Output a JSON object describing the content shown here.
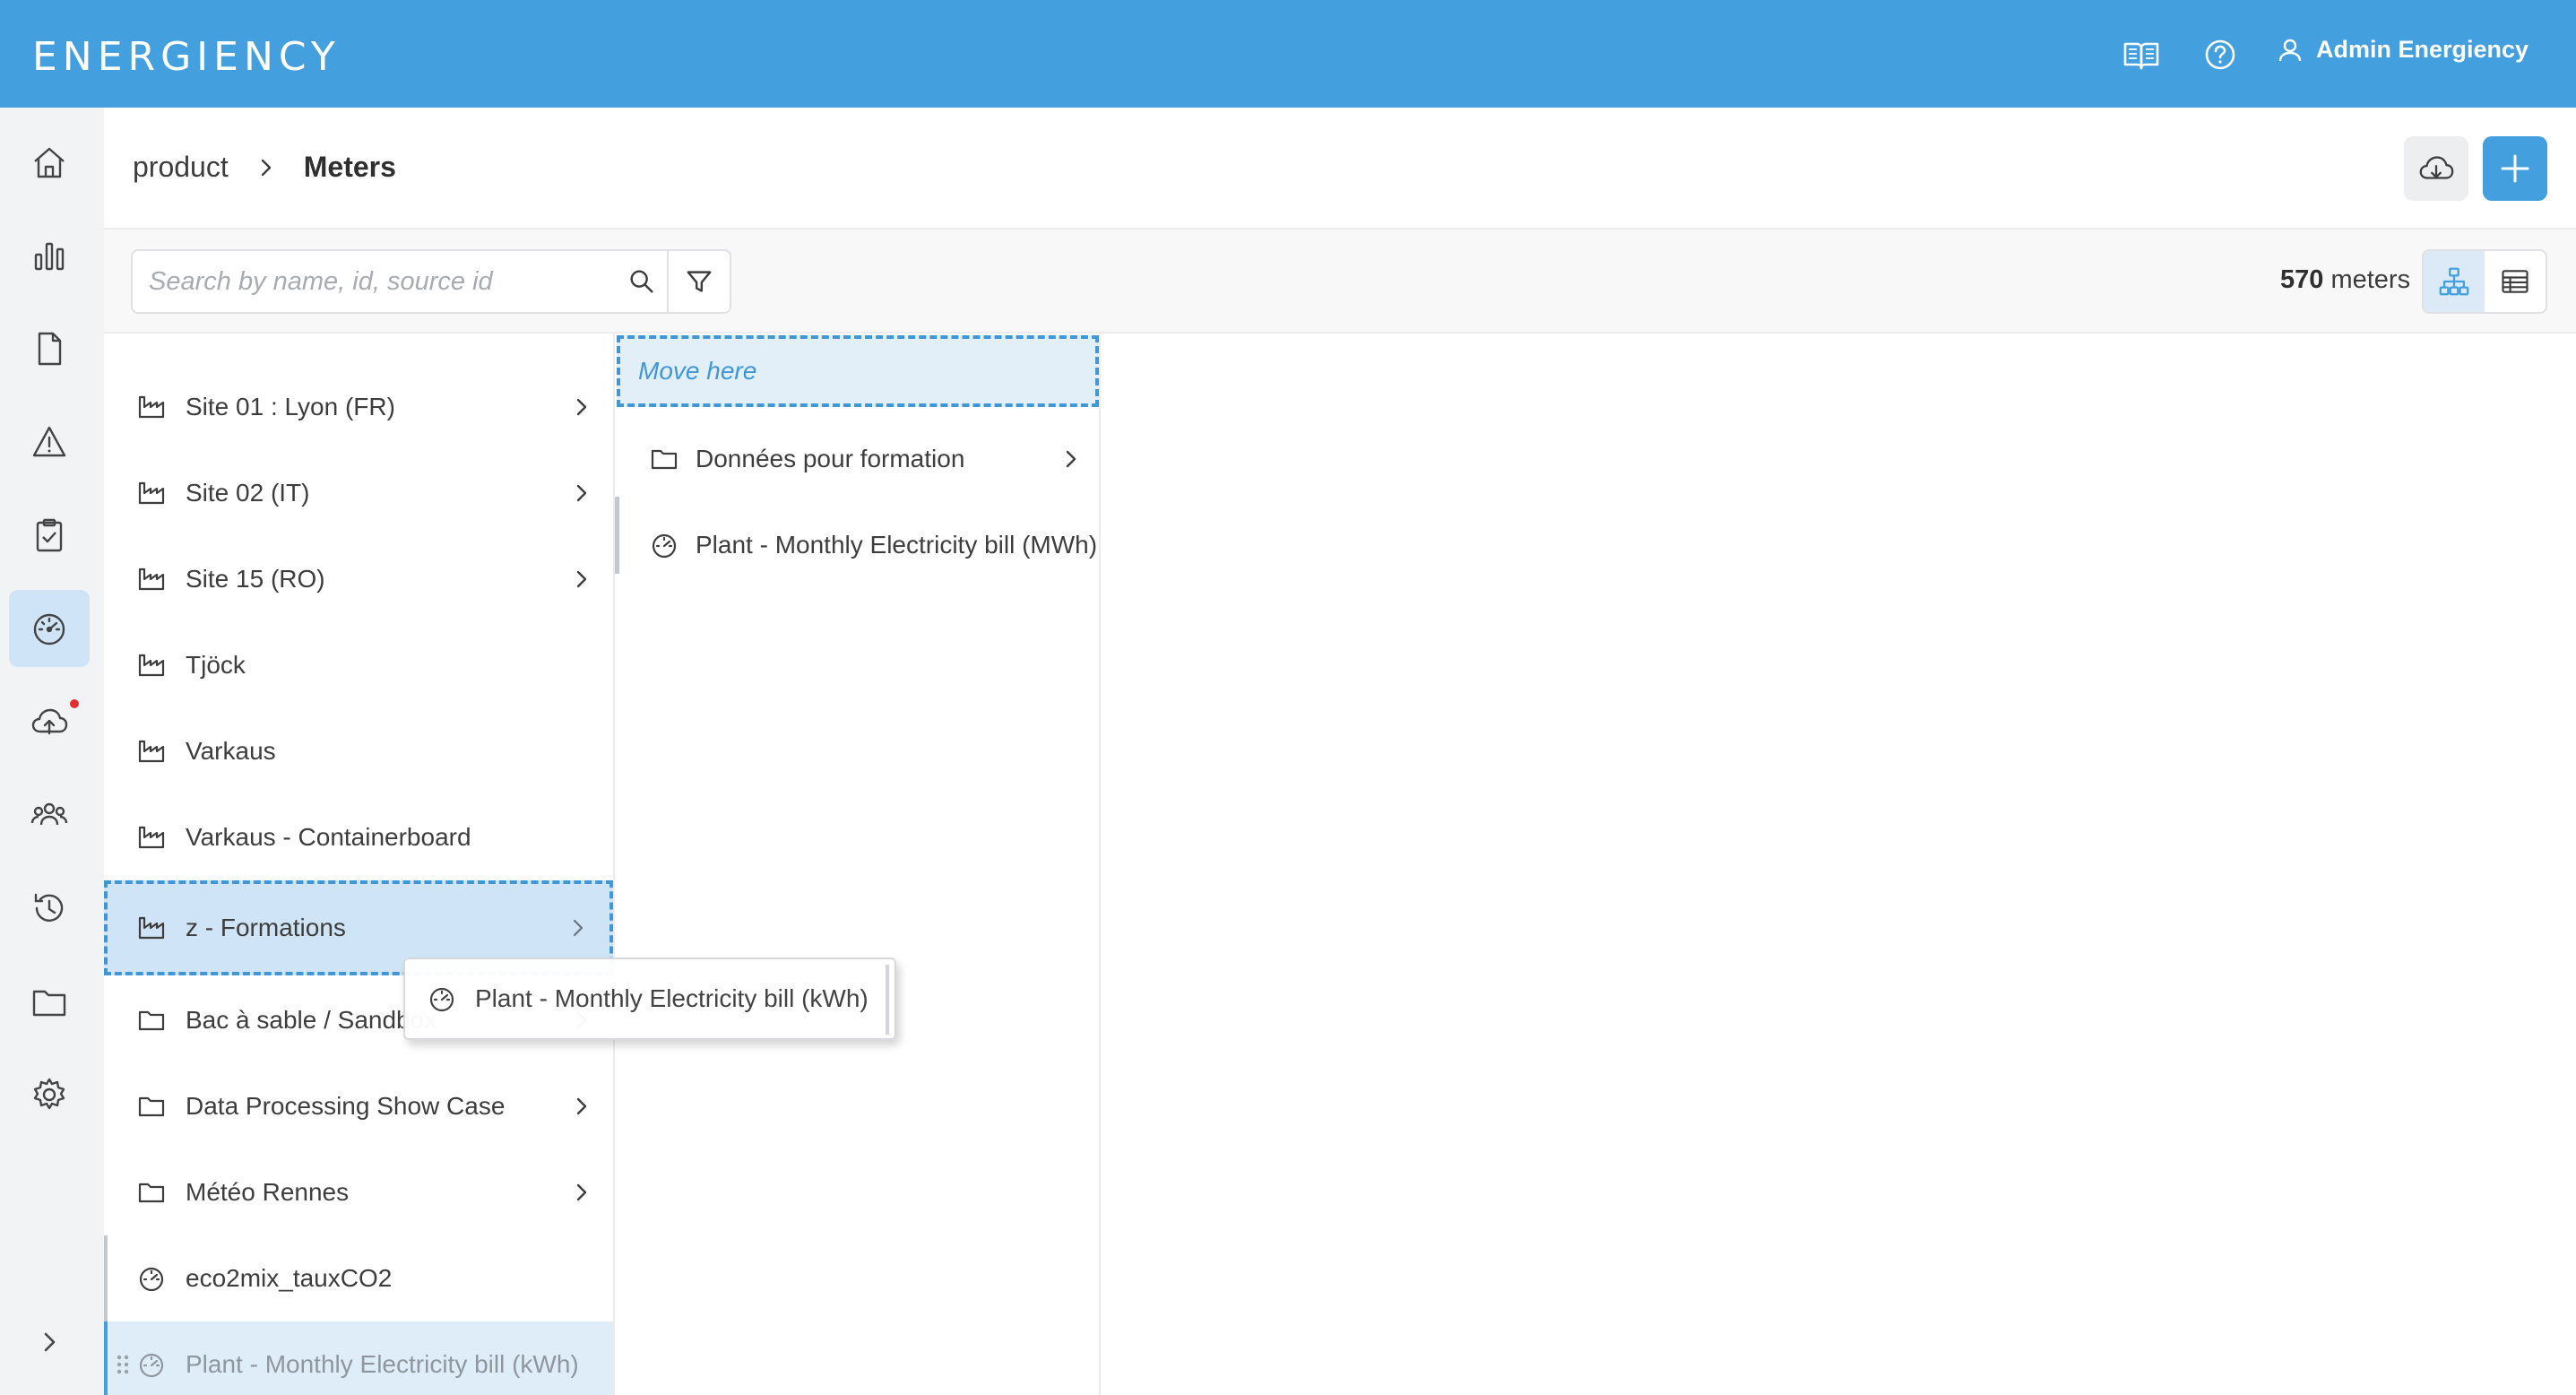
{
  "app": {
    "logo": "ENERGIENCY",
    "user_name": "Admin Energiency"
  },
  "topbar": {
    "icons": [
      "book-icon",
      "help-icon",
      "user-icon"
    ]
  },
  "sidebar": {
    "items": [
      "home-icon",
      "analytics-icon",
      "document-icon",
      "alert-icon",
      "clipboard-check-icon",
      "meter-gauge-icon",
      "cloud-upload-icon",
      "users-icon",
      "history-icon",
      "folder-icon",
      "settings-icon"
    ],
    "active": "meter-gauge-icon",
    "expand_icon": "chevron-right-icon"
  },
  "breadcrumb": {
    "root": "product",
    "current": "Meters"
  },
  "toolbar": {
    "search_placeholder": "Search by name, id, source id",
    "count_number": "570",
    "count_label": "meters"
  },
  "column1": {
    "rows": [
      {
        "label": "Site 01 : Lyon (FR)",
        "icon": "site-icon",
        "has_children": true
      },
      {
        "label": "Site 02 (IT)",
        "icon": "site-icon",
        "has_children": true
      },
      {
        "label": "Site 15 (RO)",
        "icon": "site-icon",
        "has_children": true
      },
      {
        "label": "Tjöck",
        "icon": "site-icon",
        "has_children": false
      },
      {
        "label": "Varkaus",
        "icon": "site-icon",
        "has_children": false
      },
      {
        "label": "Varkaus - Containerboard",
        "icon": "site-icon",
        "has_children": false
      },
      {
        "label": "z - Formations",
        "icon": "site-icon",
        "has_children": true
      },
      {
        "label": "Bac à sable / Sandbox",
        "icon": "folder-icon",
        "has_children": true
      },
      {
        "label": "Data Processing Show Case",
        "icon": "folder-icon",
        "has_children": true
      },
      {
        "label": "Météo Rennes",
        "icon": "folder-icon",
        "has_children": true
      },
      {
        "label": "eco2mix_tauxCO2",
        "icon": "meter-gauge-icon",
        "has_children": false
      },
      {
        "label": "Plant - Monthly Electricity bill (kWh)",
        "icon": "meter-gauge-icon",
        "has_children": false
      }
    ]
  },
  "column2": {
    "drop_hint": "Move here",
    "rows": [
      {
        "label": "Données pour formation",
        "icon": "folder-icon",
        "has_children": true
      },
      {
        "label": "Plant - Monthly Electricity bill (MWh)",
        "icon": "meter-gauge-icon",
        "has_children": false
      }
    ]
  },
  "drag_ghost": {
    "label": "Plant - Monthly Electricity bill (kWh)",
    "icon": "meter-gauge-icon"
  },
  "colors": {
    "brand": "#439fde",
    "drop_target": "#cfe4f6",
    "alert_dot": "#e03131"
  }
}
